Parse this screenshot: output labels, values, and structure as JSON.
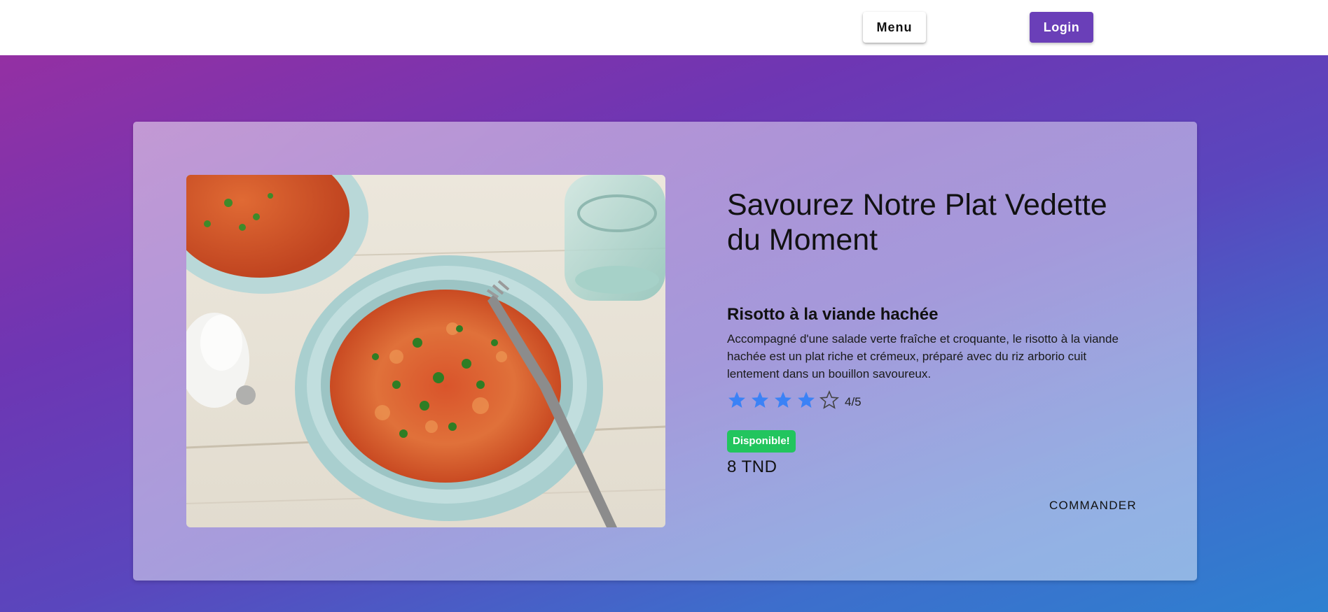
{
  "nav": {
    "menu_label": "Menu",
    "login_label": "Login",
    "login_color": "#6a3fb8"
  },
  "featured": {
    "headline": "Savourez Notre Plat Vedette du Moment",
    "image_icon": "risotto-dish-image",
    "dish_name": "Risotto à la viande hachée",
    "description": "Accompagné d'une salade verte fraîche et croquante, le risotto à la viande hachée est un plat riche et crémeux, préparé avec du riz arborio cuit lentement dans un bouillon savoureux.",
    "rating": 4,
    "rating_max": 5,
    "rating_text": "4/5",
    "star_color": "#3b82f6",
    "availability": "Disponible!",
    "availability_color": "#22c55e",
    "price": "8 TND",
    "order_label": "COMMANDER"
  },
  "theme": {
    "gradient_start": "#9430a3",
    "gradient_end": "#2e80d0"
  }
}
